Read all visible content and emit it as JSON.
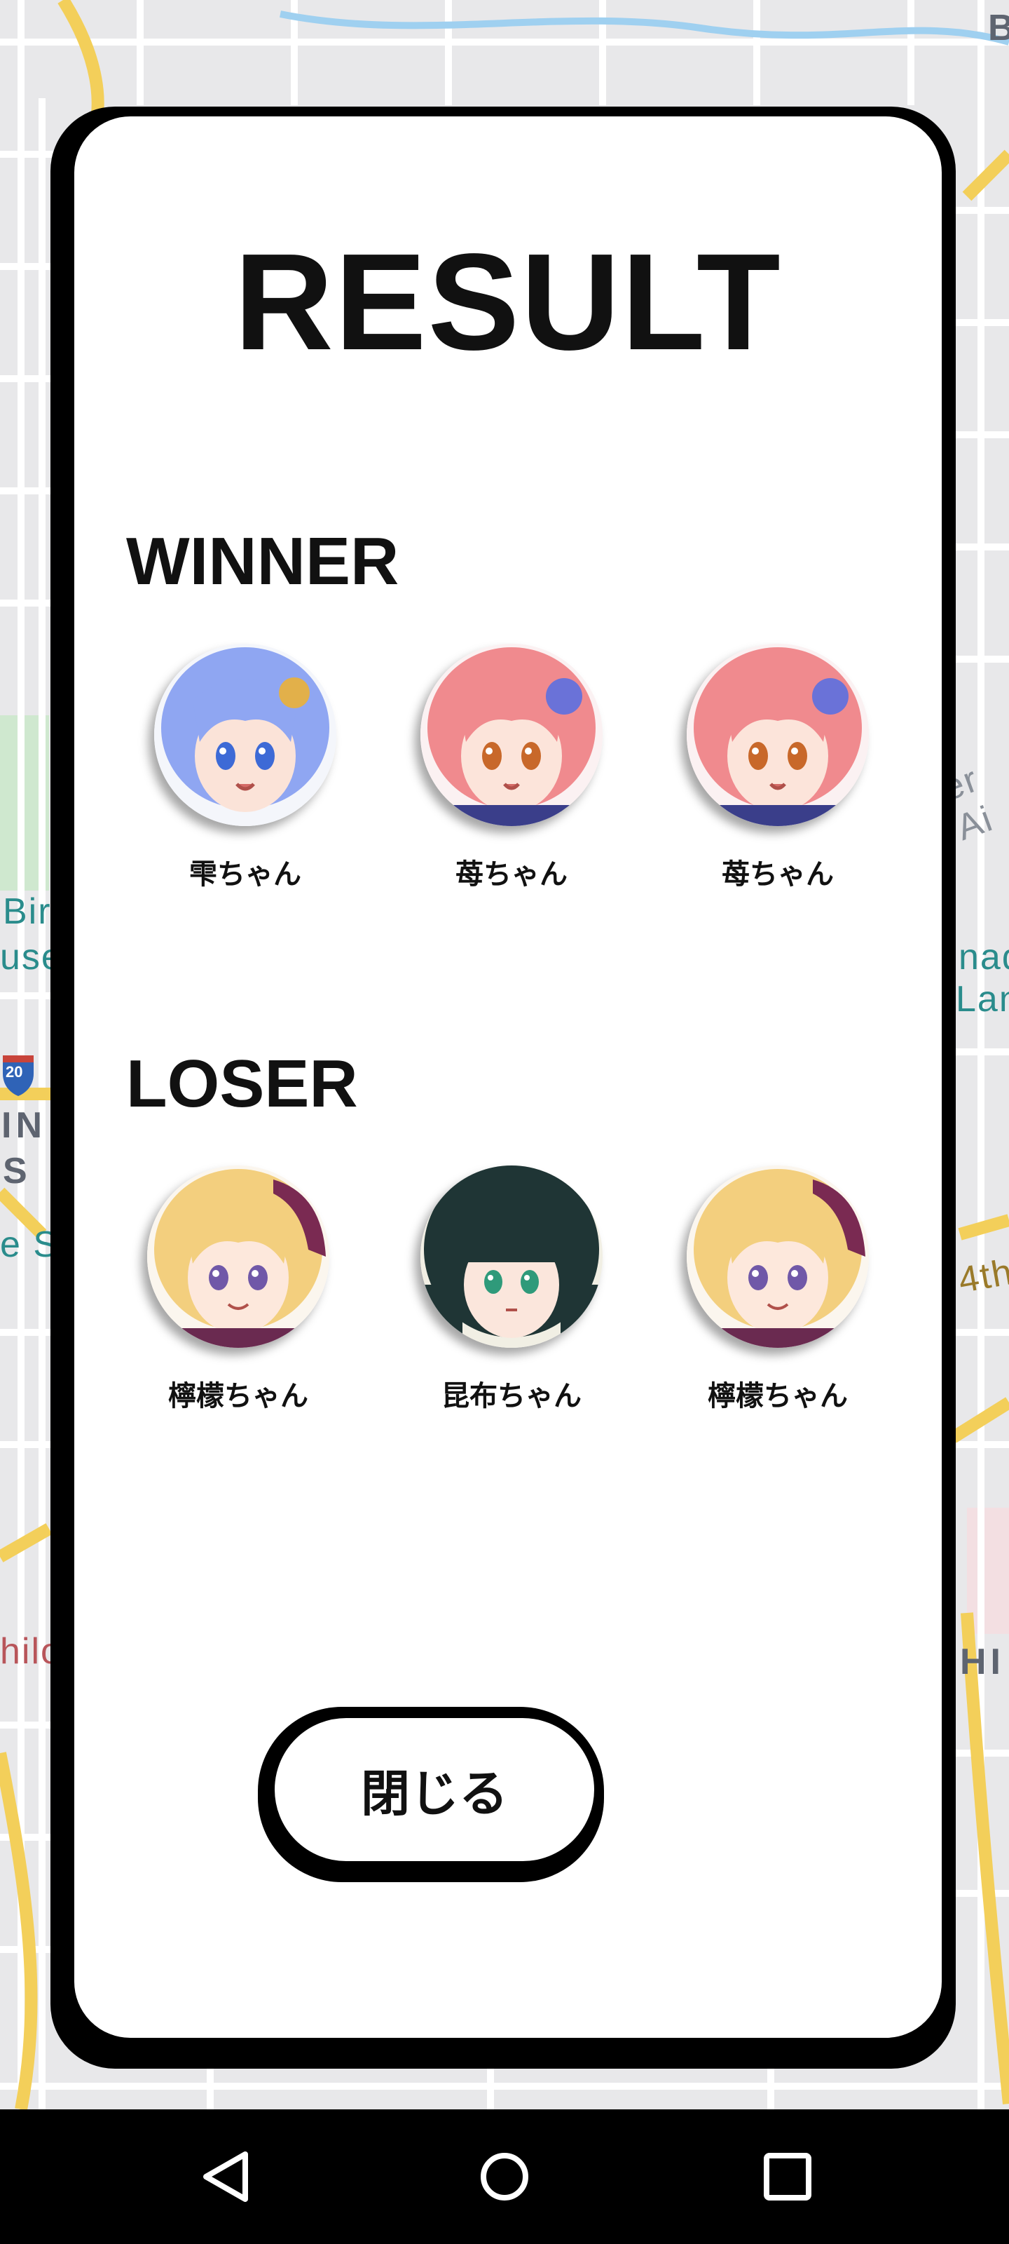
{
  "dialog": {
    "title": "RESULT",
    "winner_heading": "WINNER",
    "loser_heading": "LOSER",
    "close_label": "閉じる"
  },
  "winners": [
    {
      "name": "雫ちゃん",
      "hair": "#8fa6f2",
      "eyes": "#3d6ad6"
    },
    {
      "name": "苺ちゃん",
      "hair": "#f08a8e",
      "eyes": "#c8682a"
    },
    {
      "name": "苺ちゃん",
      "hair": "#f08a8e",
      "eyes": "#c8682a"
    }
  ],
  "losers": [
    {
      "name": "檸檬ちゃん",
      "hair": "#f3cf7e",
      "eyes": "#7058a8"
    },
    {
      "name": "昆布ちゃん",
      "hair": "#1f3535",
      "eyes": "#2f9a7a"
    },
    {
      "name": "檸檬ちゃん",
      "hair": "#f3cf7e",
      "eyes": "#7058a8"
    }
  ],
  "map_labels": {
    "top_right": "B",
    "left_bird": "Bir",
    "left_muse": "use",
    "left_in": "IN",
    "left_s": "S",
    "left_sc": "e Sc",
    "left_hilo": "hilo",
    "right_air": "er Ai",
    "right_nad": "nad",
    "right_land": "Land",
    "right_4th": "4th",
    "right_hi": "HI",
    "left_shield": "20"
  },
  "nav": {
    "back_icon": "back-triangle-icon",
    "home_icon": "home-circle-icon",
    "recents_icon": "recents-square-icon"
  }
}
